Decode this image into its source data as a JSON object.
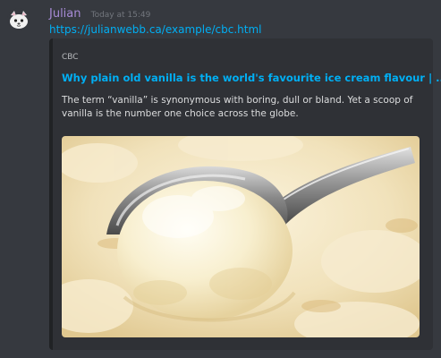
{
  "message": {
    "author": "Julian",
    "timestamp": "Today at 15:49",
    "link": "https://julianwebb.ca/example/cbc.html"
  },
  "embed": {
    "provider": "CBC",
    "title": "Why plain old vanilla is the world's favourite ice cream flavour | ...",
    "description": "The term “vanilla” is synonymous with boring, dull or bland. Yet a scoop of vanilla is the number one choice across the globe.",
    "image_alt": "scoop of vanilla ice cream with metal scoop"
  },
  "colors": {
    "background": "#36393f",
    "embed_background": "#2f3136",
    "author": "#a78bd6",
    "link": "#00aff4"
  }
}
